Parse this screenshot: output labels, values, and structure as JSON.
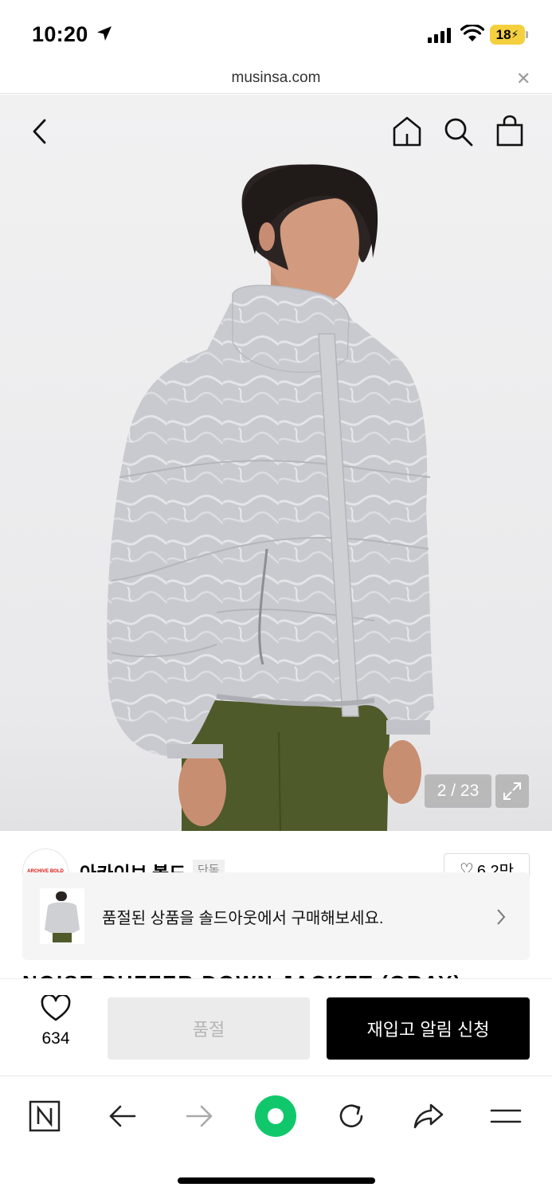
{
  "status_bar": {
    "time": "10:20",
    "battery": "18"
  },
  "url_bar": {
    "domain": "musinsa.com"
  },
  "image": {
    "counter": "2 / 23"
  },
  "brand": {
    "logo_text": "ARCHIVE BOLD",
    "name": "아카이브 볼드",
    "tag": "단독",
    "likes": "6.2만"
  },
  "product": {
    "title": "NOISE PUFFER DOWN JACKET (GRAY)"
  },
  "soldout_banner": {
    "text": "품절된 상품을 솔드아웃에서 구매해보세요."
  },
  "action_bar": {
    "like_count": "634",
    "soldout_label": "품절",
    "restock_label": "재입고 알림 신청"
  },
  "colors": {
    "accent_green": "#10c86b",
    "restock_bg": "#000000",
    "battery": "#f4d03f"
  },
  "icons": [
    "location-arrow-icon",
    "signal-icon",
    "wifi-icon",
    "back-icon",
    "home-icon",
    "search-icon",
    "bag-icon",
    "expand-icon",
    "heart-icon",
    "chevron-right-icon",
    "naver-icon",
    "arrow-left-icon",
    "arrow-right-icon",
    "green-dot-icon",
    "reload-icon",
    "share-icon",
    "menu-icon"
  ]
}
